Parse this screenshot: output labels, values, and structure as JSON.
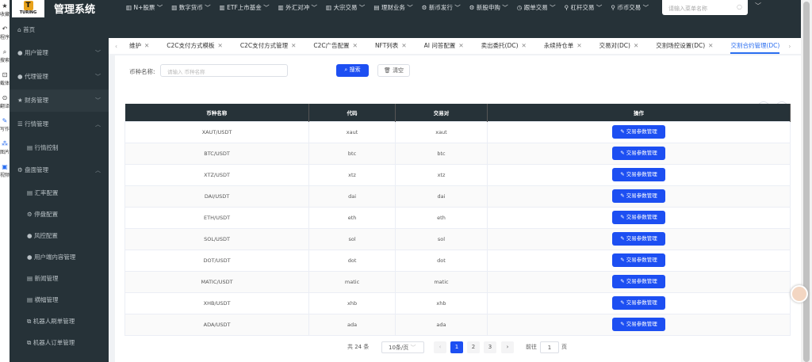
{
  "extension_bar": [
    {
      "icon": "star-icon",
      "label": "收藏"
    },
    {
      "icon": "undo-icon",
      "label": "程序"
    },
    {
      "icon": "search-icon",
      "label": "搜索"
    },
    {
      "icon": "screenshot-icon",
      "label": "截体"
    },
    {
      "icon": "translate-icon",
      "label": "翻译"
    },
    {
      "icon": "edit-icon",
      "label": "写作"
    },
    {
      "icon": "image-icon",
      "label": "图片"
    },
    {
      "icon": "video-icon",
      "label": "视频"
    }
  ],
  "header": {
    "logo_text": "TURING",
    "title": "管理系统",
    "menu": [
      "N+股票",
      "数字货币",
      "ETF上市基金",
      "外汇对冲",
      "大宗交易",
      "理财业务",
      "新币发行",
      "新股申购",
      "跟单交易",
      "杠杆交易",
      "币币交易"
    ],
    "search_placeholder": "请输入菜单名称"
  },
  "sidebar": {
    "items": [
      {
        "label": "首页",
        "icon": "home-icon"
      },
      {
        "label": "用户管理",
        "icon": "user-icon",
        "chev": "﹀"
      },
      {
        "label": "代理管理",
        "icon": "user-icon",
        "chev": "﹀"
      },
      {
        "label": "财务管理",
        "icon": "star-icon",
        "chev": "﹀"
      },
      {
        "label": "行情管理",
        "icon": "list-icon",
        "chev": "︿"
      },
      {
        "label": "行情控制",
        "icon": "doc-icon",
        "sub": true
      },
      {
        "label": "盘面管理",
        "icon": "gear-icon",
        "chev": "︿"
      },
      {
        "label": "汇率配置",
        "icon": "doc-icon",
        "sub": true
      },
      {
        "label": "停盘配置",
        "icon": "gear-icon",
        "sub": true
      },
      {
        "label": "风控配置",
        "icon": "user-icon",
        "sub": true
      },
      {
        "label": "用户端内容管理",
        "icon": "user-icon",
        "sub": true
      },
      {
        "label": "新闻管理",
        "icon": "doc-icon",
        "sub": true
      },
      {
        "label": "横幅管理",
        "icon": "doc-icon",
        "sub": true
      },
      {
        "label": "机器人刷单管理",
        "icon": "robot-icon",
        "sub": true
      },
      {
        "label": "机器人订单管理",
        "icon": "robot-icon",
        "sub": true
      }
    ]
  },
  "tabs": [
    {
      "label": "维护"
    },
    {
      "label": "C2C支付方式模板"
    },
    {
      "label": "C2C支付方式管理"
    },
    {
      "label": "C2C广告配置"
    },
    {
      "label": "NFT列表"
    },
    {
      "label": "AI 问答配置"
    },
    {
      "label": "卖出委托(DC)"
    },
    {
      "label": "永续持仓单"
    },
    {
      "label": "交易对(DC)"
    },
    {
      "label": "交割场控设置(DC)"
    },
    {
      "label": "交割合约管理(DC)",
      "active": true
    }
  ],
  "filter": {
    "label": "币种名称:",
    "placeholder": "请输入 币种名称",
    "search": "搜索",
    "clear": "清空"
  },
  "table": {
    "columns": [
      "币种名称",
      "代码",
      "交易对",
      "操作"
    ],
    "action_label": "交易参数管理",
    "rows": [
      [
        "XAUT/USDT",
        "xaut",
        "xaut"
      ],
      [
        "BTC/USDT",
        "btc",
        "btc"
      ],
      [
        "XTZ/USDT",
        "xtz",
        "xtz"
      ],
      [
        "DAI/USDT",
        "dai",
        "dai"
      ],
      [
        "ETH/USDT",
        "eth",
        "eth"
      ],
      [
        "SOL/USDT",
        "sol",
        "sol"
      ],
      [
        "DOT/USDT",
        "dot",
        "dot"
      ],
      [
        "MATIC/USDT",
        "matic",
        "matic"
      ],
      [
        "XHB/USDT",
        "xhb",
        "xhb"
      ],
      [
        "ADA/USDT",
        "ada",
        "ada"
      ]
    ]
  },
  "pagination": {
    "total": "共 24 条",
    "page_size": "10条/页",
    "pages": [
      "1",
      "2",
      "3"
    ],
    "current": "1",
    "goto_label": "前往",
    "goto_value": "1",
    "page_suffix": "页"
  }
}
